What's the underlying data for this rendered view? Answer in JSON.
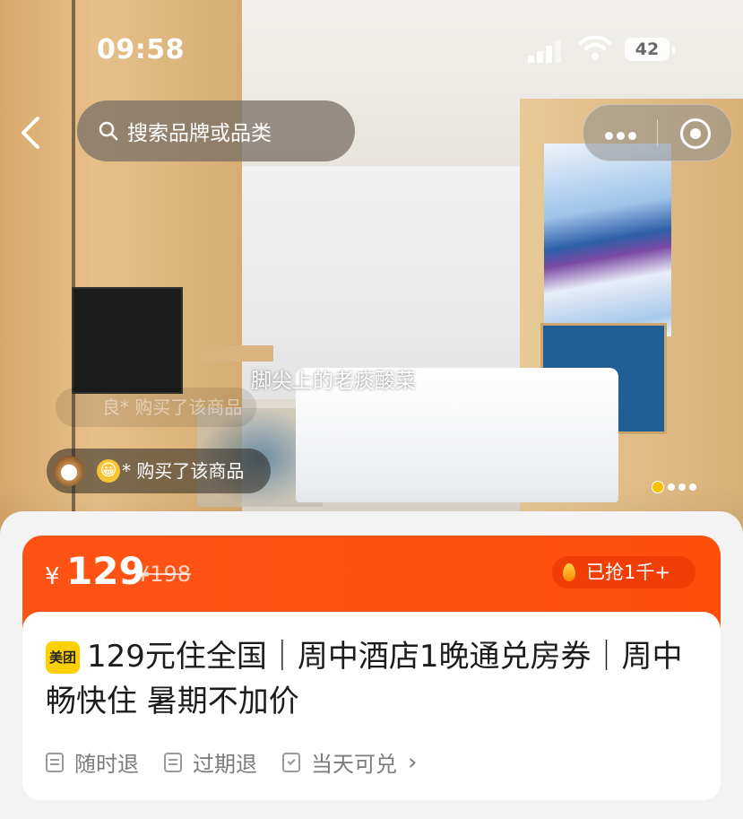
{
  "status_bar": {
    "time": "09:58",
    "battery": "42"
  },
  "nav": {
    "search_placeholder": "搜索品牌或品类"
  },
  "photo": {
    "watermark": "脚尖上的老痰酸菜",
    "purchase_ghost": "良* 购买了该商品",
    "purchase_notice": "* 购买了该商品",
    "emoji": "😀",
    "carousel_count": 5,
    "carousel_active": 1
  },
  "product": {
    "currency": "¥",
    "price": "129",
    "original_price": "¥198",
    "sold_label": "已抢1千+",
    "brand_badge": "美团",
    "title": "129元住全国｜周中酒店1晚通兑房券｜周中畅快住 暑期不加价",
    "tags": [
      {
        "label": "随时退",
        "icon": "document-icon"
      },
      {
        "label": "过期退",
        "icon": "document-icon"
      },
      {
        "label": "当天可兑",
        "icon": "calendar-check-icon"
      }
    ],
    "chevron": "›"
  },
  "colors": {
    "accent": "#ff5316",
    "sold_pill": "#f03e05",
    "brand_yellow": "#ffd000",
    "carousel_active": "#f6c200"
  }
}
